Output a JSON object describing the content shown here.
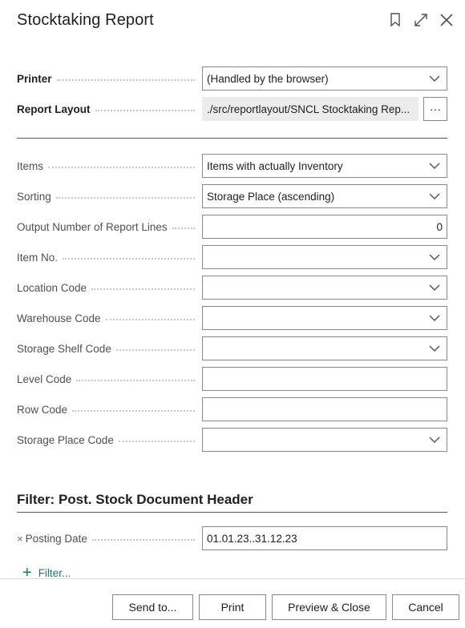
{
  "dialog": {
    "title": "Stocktaking Report",
    "icons": {
      "bookmark": "bookmark-icon",
      "expand": "expand-icon",
      "close": "close-icon"
    }
  },
  "options": {
    "printer": {
      "label": "Printer",
      "value": "(Handled by the browser)"
    },
    "report_layout": {
      "label": "Report Layout",
      "value": "./src/reportlayout/SNCL Stocktaking Rep...",
      "assist": "···"
    }
  },
  "fields": [
    {
      "label": "Items",
      "value": "Items with actually Inventory",
      "dropdown": true
    },
    {
      "label": "Sorting",
      "value": "Storage Place (ascending)",
      "dropdown": true
    },
    {
      "label": "Output Number of Report Lines",
      "value": "0",
      "dropdown": false
    },
    {
      "label": "Item No.",
      "value": "",
      "dropdown": true
    },
    {
      "label": "Location Code",
      "value": "",
      "dropdown": true
    },
    {
      "label": "Warehouse Code",
      "value": "",
      "dropdown": true
    },
    {
      "label": "Storage Shelf Code",
      "value": "",
      "dropdown": true
    },
    {
      "label": "Level Code",
      "value": "",
      "dropdown": false
    },
    {
      "label": "Row Code",
      "value": "",
      "dropdown": false
    },
    {
      "label": "Storage Place Code",
      "value": "",
      "dropdown": true
    }
  ],
  "filter_section": {
    "title": "Filter: Post. Stock Document Header",
    "posting_date": {
      "remove": "×",
      "label": "Posting Date",
      "value": "01.01.23..31.12.23"
    },
    "add_filter": {
      "plus": "+",
      "label": "Filter..."
    }
  },
  "buttons": {
    "send_to": "Send to...",
    "print": "Print",
    "preview_close": "Preview & Close",
    "cancel": "Cancel"
  },
  "colors": {
    "accent": "#0f7b83",
    "border": "#8a8a8a",
    "readonly_bg": "#ececec"
  }
}
